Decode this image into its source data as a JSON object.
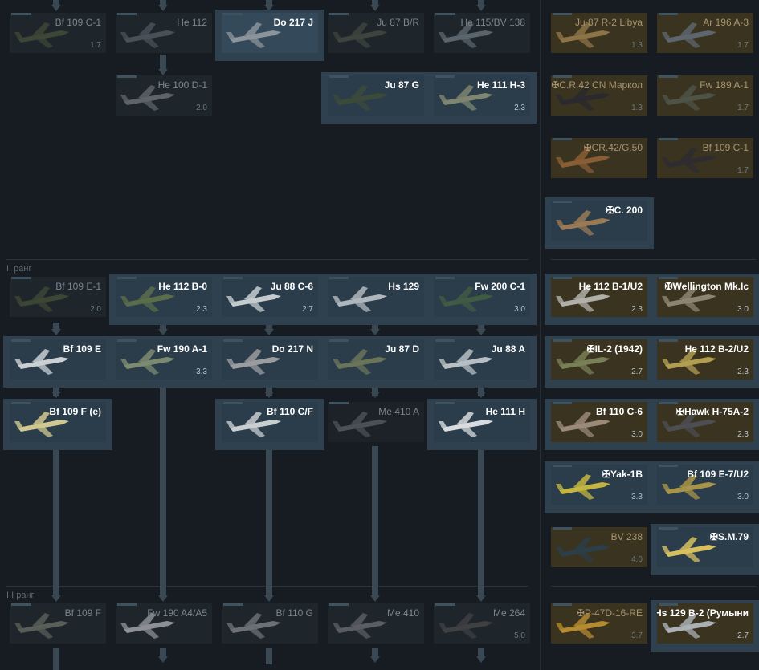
{
  "ranks": {
    "r2": "II ранг",
    "r3": "III ранг"
  },
  "vehicles": [
    {
      "id": "bf109c1",
      "name": "Bf 109 C-1",
      "br": "1.7",
      "state": "locked",
      "color": "#3d4736"
    },
    {
      "id": "he112",
      "name": "He 112",
      "br": "",
      "state": "locked",
      "color": "#4a5058"
    },
    {
      "id": "do217j",
      "name": "Do 217 J",
      "br": "",
      "state": "sel",
      "color": "#8c939a"
    },
    {
      "id": "ju87br",
      "name": "Ju 87 B/R",
      "br": "",
      "state": "locked",
      "color": "#3c443d"
    },
    {
      "id": "he115",
      "name": "He 115/BV 138",
      "br": "",
      "state": "locked",
      "color": "#5a646c"
    },
    {
      "id": "ju87r2",
      "name": "Ju 87 R-2 Libya",
      "br": "1.3",
      "state": "prem",
      "color": "#8d7447"
    },
    {
      "id": "ar196",
      "name": "Ar 196 A-3",
      "br": "1.7",
      "state": "prem",
      "color": "#5d666e"
    },
    {
      "id": "he100d1",
      "name": "He 100 D-1",
      "br": "2.0",
      "state": "locked",
      "color": "#5e6369"
    },
    {
      "id": "ju87g",
      "name": "Ju 87 G",
      "br": "",
      "state": "owned",
      "color": "#3c4a39"
    },
    {
      "id": "he111h3",
      "name": "He 111 H-3",
      "br": "2.3",
      "state": "owned",
      "color": "#7e8570"
    },
    {
      "id": "cr42cn",
      "name": "✠C.R.42 CN Маркол",
      "br": "1.3",
      "state": "prem",
      "color": "#2a2a2e"
    },
    {
      "id": "fw189",
      "name": "Fw 189 A-1",
      "br": "1.7",
      "state": "prem",
      "color": "#4e5346"
    },
    {
      "id": "cr42g50",
      "name": "✠CR.42/G.50",
      "br": "",
      "state": "prem",
      "color": "#8a5e34"
    },
    {
      "id": "bf109c1b",
      "name": "Bf 109 C-1",
      "br": "1.7",
      "state": "prem",
      "color": "#2e2c30"
    },
    {
      "id": "c200",
      "name": "✠C. 200",
      "br": "",
      "state": "owned",
      "color": "#9a7a55"
    },
    {
      "id": "bf109e1",
      "name": "Bf 109 E-1",
      "br": "2.0",
      "state": "locked",
      "color": "#3c4634"
    },
    {
      "id": "he112b0",
      "name": "He 112 B-0",
      "br": "2.3",
      "state": "owned",
      "color": "#5a6c4a"
    },
    {
      "id": "ju88c6",
      "name": "Ju 88 C-6",
      "br": "2.7",
      "state": "owned",
      "color": "#c5ccd0"
    },
    {
      "id": "hs129",
      "name": "Hs 129",
      "br": "",
      "state": "owned",
      "color": "#b0b7bc"
    },
    {
      "id": "fw200",
      "name": "Fw 200 C-1",
      "br": "3.0",
      "state": "owned",
      "color": "#3f5b44"
    },
    {
      "id": "he112b1u2",
      "name": "He 112 B-1/U2",
      "br": "2.3",
      "state": "prem owned",
      "color": "#b0b0a8"
    },
    {
      "id": "wellington",
      "name": "✠Wellington Mk.Ic",
      "br": "3.0",
      "state": "prem owned",
      "color": "#8e8570"
    },
    {
      "id": "bf109e",
      "name": "Bf 109 E",
      "br": "",
      "state": "owned",
      "color": "#cbd0d3"
    },
    {
      "id": "fw190a1",
      "name": "Fw 190 A-1",
      "br": "3.3",
      "state": "owned",
      "color": "#7c8a70"
    },
    {
      "id": "do217n",
      "name": "Do 217 N",
      "br": "",
      "state": "owned",
      "color": "#9b9ca0"
    },
    {
      "id": "ju87d",
      "name": "Ju 87 D",
      "br": "",
      "state": "owned",
      "color": "#6a7458"
    },
    {
      "id": "ju88a",
      "name": "Ju 88 A",
      "br": "",
      "state": "owned",
      "color": "#b8bfc4"
    },
    {
      "id": "il2",
      "name": "✠IL-2 (1942)",
      "br": "2.7",
      "state": "prem owned",
      "color": "#7a8056"
    },
    {
      "id": "he112b2u2",
      "name": "He 112 B-2/U2",
      "br": "2.3",
      "state": "prem owned",
      "color": "#b29e52"
    },
    {
      "id": "bf109fe",
      "name": "Bf 109 F (e)",
      "br": "",
      "state": "owned",
      "color": "#d0c890"
    },
    {
      "id": "bf110cf",
      "name": "Bf 110 C/F",
      "br": "",
      "state": "owned",
      "color": "#c9ced1"
    },
    {
      "id": "me410a",
      "name": "Me 410 A",
      "br": "",
      "state": "dim",
      "color": "#4a5055"
    },
    {
      "id": "he111h",
      "name": "He 111 H",
      "br": "",
      "state": "owned",
      "color": "#d8dcde"
    },
    {
      "id": "bf110c6",
      "name": "Bf 110 C-6",
      "br": "3.0",
      "state": "prem owned",
      "color": "#9c8a78"
    },
    {
      "id": "hawk75",
      "name": "✠Hawk H-75A-2",
      "br": "2.3",
      "state": "prem owned",
      "color": "#4c4e52"
    },
    {
      "id": "yak1b",
      "name": "✠Yak-1B",
      "br": "3.3",
      "state": "owned",
      "color": "#c2b640"
    },
    {
      "id": "bf109e7u2",
      "name": "Bf 109 E-7/U2",
      "br": "3.0",
      "state": "owned",
      "color": "#a89448"
    },
    {
      "id": "bv238",
      "name": "BV 238",
      "br": "4.0",
      "state": "prem",
      "color": "#2c3e48"
    },
    {
      "id": "sm79",
      "name": "✠S.M.79",
      "br": "",
      "state": "owned",
      "color": "#d8c060"
    },
    {
      "id": "bf109f",
      "name": "Bf 109 F",
      "br": "",
      "state": "locked",
      "color": "#5a5e58"
    },
    {
      "id": "fw190a4",
      "name": "Fw 190 A4/A5",
      "br": "",
      "state": "locked",
      "color": "#8c9094"
    },
    {
      "id": "bf110g",
      "name": "Bf 110 G",
      "br": "",
      "state": "locked",
      "color": "#6c7074"
    },
    {
      "id": "me410",
      "name": "Me 410",
      "br": "",
      "state": "locked",
      "color": "#5a5e62"
    },
    {
      "id": "me264",
      "name": "Me 264",
      "br": "5.0",
      "state": "locked",
      "color": "#3e4042"
    },
    {
      "id": "p47",
      "name": "✠P-47D-16-RE",
      "br": "3.7",
      "state": "prem",
      "color": "#b58a30"
    },
    {
      "id": "hs129b2r",
      "name": "Hs 129 B-2 (Румыни",
      "br": "2.7",
      "state": "prem owned",
      "color": "#aab0b4"
    }
  ]
}
